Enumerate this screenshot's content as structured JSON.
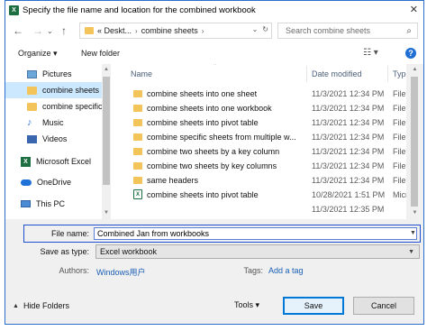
{
  "window": {
    "title": "Specify the file name and location for the combined workbook",
    "app_icon": "X",
    "close_glyph": "✕"
  },
  "navigation": {
    "back": "←",
    "forward": "→",
    "up": "↑",
    "breadcrumb": [
      "« Deskt...",
      "combine sheets"
    ],
    "refresh": "↻",
    "search_placeholder": "Search combine sheets"
  },
  "toolbar": {
    "organize": "Organize ▾",
    "new_folder": "New folder",
    "view": "☷ ▾",
    "help": "?"
  },
  "sidebar": {
    "items": [
      {
        "label": "Pictures",
        "icon": "pictures-icon"
      },
      {
        "label": "combine sheets",
        "icon": "folder-icon",
        "selected": true
      },
      {
        "label": "combine specific",
        "icon": "folder-icon"
      },
      {
        "label": "Music",
        "icon": "music-icon"
      },
      {
        "label": "Videos",
        "icon": "videos-icon"
      },
      {
        "label": "Microsoft Excel",
        "icon": "excel-icon"
      },
      {
        "label": "OneDrive",
        "icon": "onedrive-icon"
      },
      {
        "label": "This PC",
        "icon": "pc-icon"
      }
    ]
  },
  "file_list": {
    "columns": {
      "name": "Name",
      "date": "Date modified",
      "type": "Type"
    },
    "rows": [
      {
        "name": "combine sheets into one sheet",
        "date": "11/3/2021 12:34 PM",
        "type": "File fol",
        "kind": "folder"
      },
      {
        "name": "combine sheets into one workbook",
        "date": "11/3/2021 12:34 PM",
        "type": "File fol",
        "kind": "folder"
      },
      {
        "name": "combine sheets into pivot table",
        "date": "11/3/2021 12:34 PM",
        "type": "File fol",
        "kind": "folder"
      },
      {
        "name": "combine specific sheets from multiple w...",
        "date": "11/3/2021 12:34 PM",
        "type": "File fol",
        "kind": "folder"
      },
      {
        "name": "combine two sheets by a key column",
        "date": "11/3/2021 12:34 PM",
        "type": "File fol",
        "kind": "folder"
      },
      {
        "name": "combine two sheets by key columns",
        "date": "11/3/2021 12:34 PM",
        "type": "File fol",
        "kind": "folder"
      },
      {
        "name": "same headers",
        "date": "11/3/2021 12:34 PM",
        "type": "File fol",
        "kind": "folder"
      },
      {
        "name": "combine sheets into pivot table",
        "date": "10/28/2021 1:51 PM",
        "type": "Micros",
        "kind": "xlsx"
      },
      {
        "name": "",
        "date": "11/3/2021 12:35 PM",
        "type": "",
        "kind": "partial"
      }
    ]
  },
  "form": {
    "file_name_label": "File name:",
    "file_name_value": "Combined Jan from workbooks",
    "save_type_label": "Save as type:",
    "save_type_value": "Excel workbook",
    "authors_label": "Authors:",
    "authors_value": "Windows用户",
    "tags_label": "Tags:",
    "tags_value": "Add a tag"
  },
  "footer": {
    "hide_folders": "Hide Folders",
    "tools": "Tools ▾",
    "save": "Save",
    "cancel": "Cancel"
  }
}
